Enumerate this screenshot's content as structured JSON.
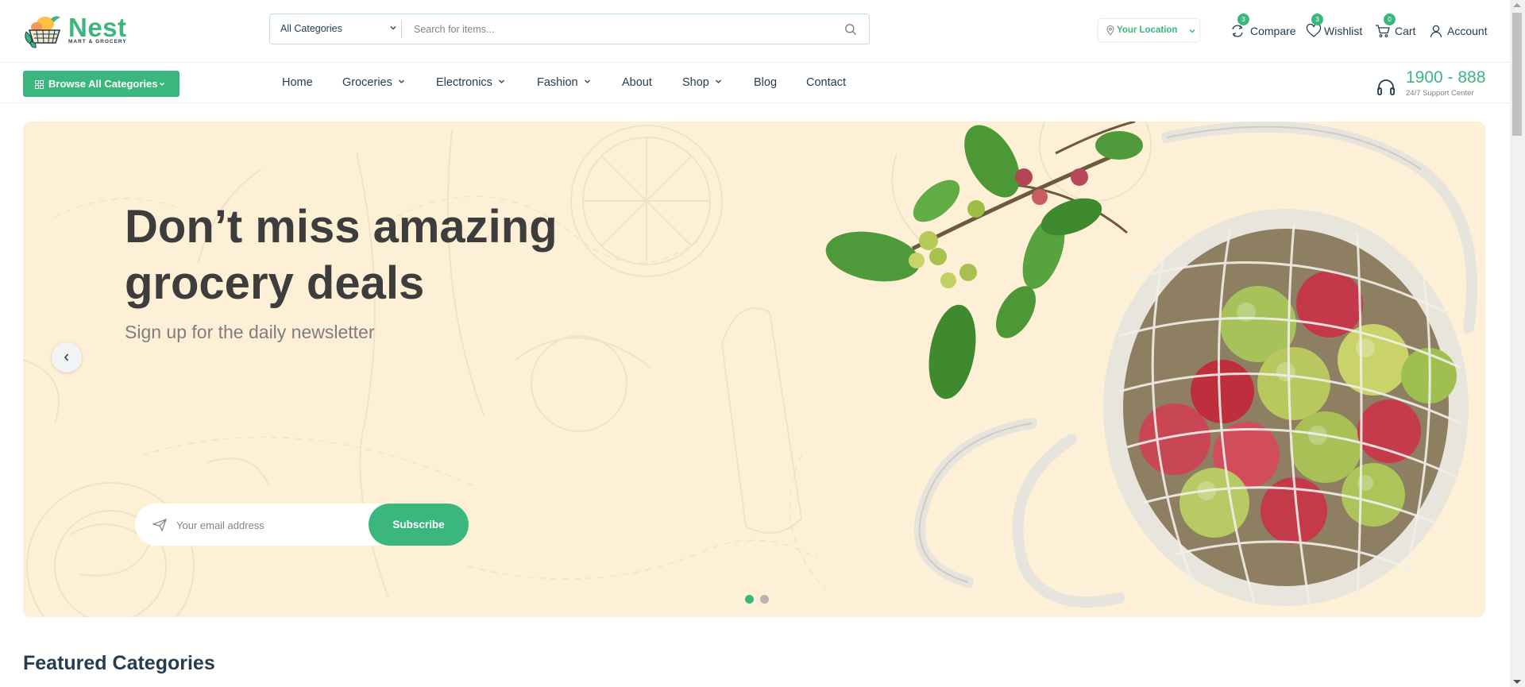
{
  "brand": {
    "name": "Nest",
    "tagline": "MART & GROCERY",
    "accent_color": "#3BB77E",
    "text_color": "#253D4E"
  },
  "header": {
    "search": {
      "category_selected": "All Categories",
      "placeholder": "Search for items...",
      "icon": "search-icon"
    },
    "location": {
      "label": "Your Location",
      "icon": "map-pin-icon"
    },
    "actions": [
      {
        "name": "compare",
        "label": "Compare",
        "badge": "3",
        "icon": "compare-icon"
      },
      {
        "name": "wishlist",
        "label": "Wishlist",
        "badge": "3",
        "icon": "heart-icon"
      },
      {
        "name": "cart",
        "label": "Cart",
        "badge": "0",
        "icon": "cart-icon"
      },
      {
        "name": "account",
        "label": "Account",
        "icon": "user-icon"
      }
    ]
  },
  "nav": {
    "browse_label": "Browse All Categories",
    "items": [
      {
        "label": "Home",
        "has_dropdown": false
      },
      {
        "label": "Groceries",
        "has_dropdown": true
      },
      {
        "label": "Electronics",
        "has_dropdown": true
      },
      {
        "label": "Fashion",
        "has_dropdown": true
      },
      {
        "label": "About",
        "has_dropdown": false
      },
      {
        "label": "Shop",
        "has_dropdown": true
      },
      {
        "label": "Blog",
        "has_dropdown": false
      },
      {
        "label": "Contact",
        "has_dropdown": false
      }
    ],
    "support": {
      "phone": "1900 - 888",
      "caption": "24/7 Support Center",
      "icon": "headset-icon"
    }
  },
  "hero": {
    "title_line1": "Don’t miss amazing",
    "title_line2": "grocery deals",
    "subtitle": "Sign up for the daily newsletter",
    "newsletter": {
      "placeholder": "Your email address",
      "button_label": "Subscribe",
      "icon": "send-icon"
    },
    "background_color": "#FEF0D6",
    "slides_total": 2,
    "active_slide": 1
  },
  "featured": {
    "title": "Featured Categories"
  }
}
